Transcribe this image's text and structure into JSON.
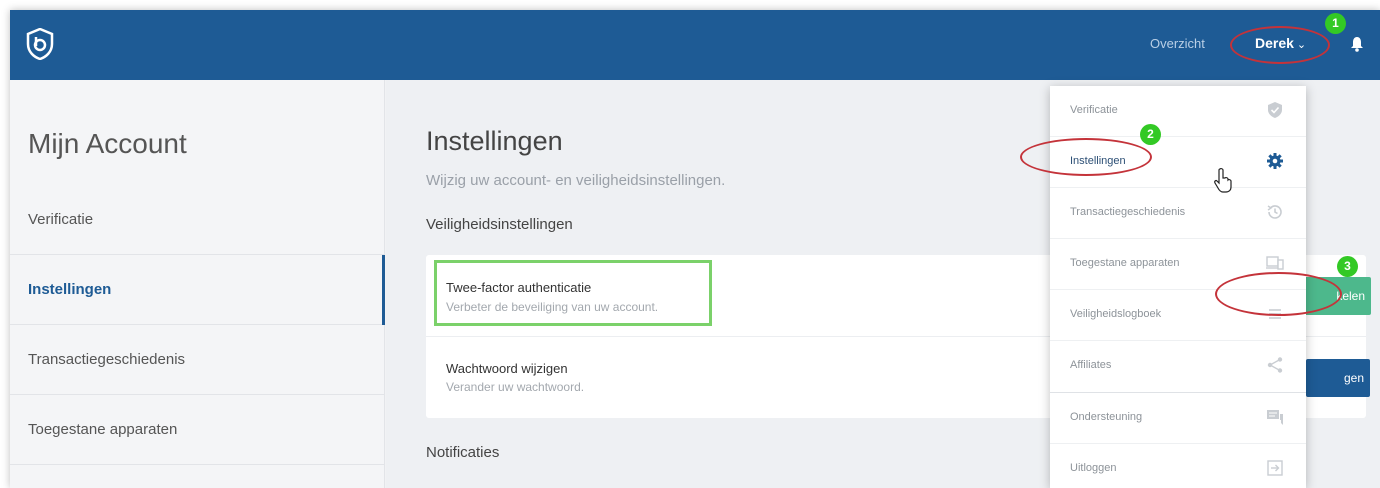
{
  "topbar": {
    "overzicht_label": "Overzicht",
    "user_name": "Derek",
    "user_chevron": "⌄",
    "brand_color": "#1e5b95"
  },
  "sidebar": {
    "title": "Mijn Account",
    "items": [
      {
        "label": "Verificatie"
      },
      {
        "label": "Instellingen",
        "active": true
      },
      {
        "label": "Transactiegeschiedenis"
      },
      {
        "label": "Toegestane apparaten"
      }
    ]
  },
  "main": {
    "title": "Instellingen",
    "subtitle": "Wijzig uw account- en veiligheidsinstellingen.",
    "security_section": "Veiligheidsinstellingen",
    "settings": [
      {
        "title": "Twee-factor authenticatie",
        "description": "Verbeter de beveiliging van uw account."
      },
      {
        "title": "Wachtwoord wijzigen",
        "description": "Verander uw wachtwoord."
      }
    ],
    "enable_button_label": "kelen",
    "change_button_label": "gen",
    "notifications_section": "Notificaties"
  },
  "dropdown": {
    "items": [
      {
        "label": "Verificatie",
        "icon": "shield-check-icon"
      },
      {
        "label": "Instellingen",
        "icon": "gear-icon"
      },
      {
        "label": "Transactiegeschiedenis",
        "icon": "history-icon"
      },
      {
        "label": "Toegestane apparaten",
        "icon": "devices-icon"
      },
      {
        "label": "Veiligheidslogboek",
        "icon": "list-icon"
      },
      {
        "label": "Affiliates",
        "icon": "share-icon"
      },
      {
        "label": "Ondersteuning",
        "icon": "chat-icon"
      },
      {
        "label": "Uitloggen",
        "icon": "logout-icon"
      }
    ]
  },
  "annotations": {
    "step1": "1",
    "step2": "2",
    "step3": "3",
    "badge_color": "#33c925",
    "oval_color": "#c4333a",
    "highlight_color": "#7bd16a"
  }
}
